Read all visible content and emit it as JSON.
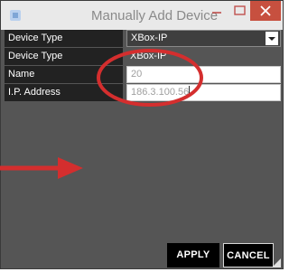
{
  "window": {
    "title": "Manually Add Device",
    "controls": {
      "minimize": "minimize-icon",
      "maximize": "maximize-icon",
      "close": "close-icon"
    }
  },
  "form": {
    "device_type_select": {
      "label": "Device Type",
      "value": "XBox-IP"
    },
    "device_type_static": {
      "label": "Device Type",
      "value": "XBox-IP"
    },
    "name": {
      "label": "Name",
      "value": "20"
    },
    "ip_address": {
      "label": "I.P. Address",
      "value": "186.3.100.56"
    }
  },
  "buttons": {
    "apply": "APPLY",
    "cancel": "CANCEL"
  },
  "colors": {
    "background": "#555555",
    "label_bg": "#222222",
    "close_button": "#c7503f",
    "annotation": "#d42e2e"
  }
}
